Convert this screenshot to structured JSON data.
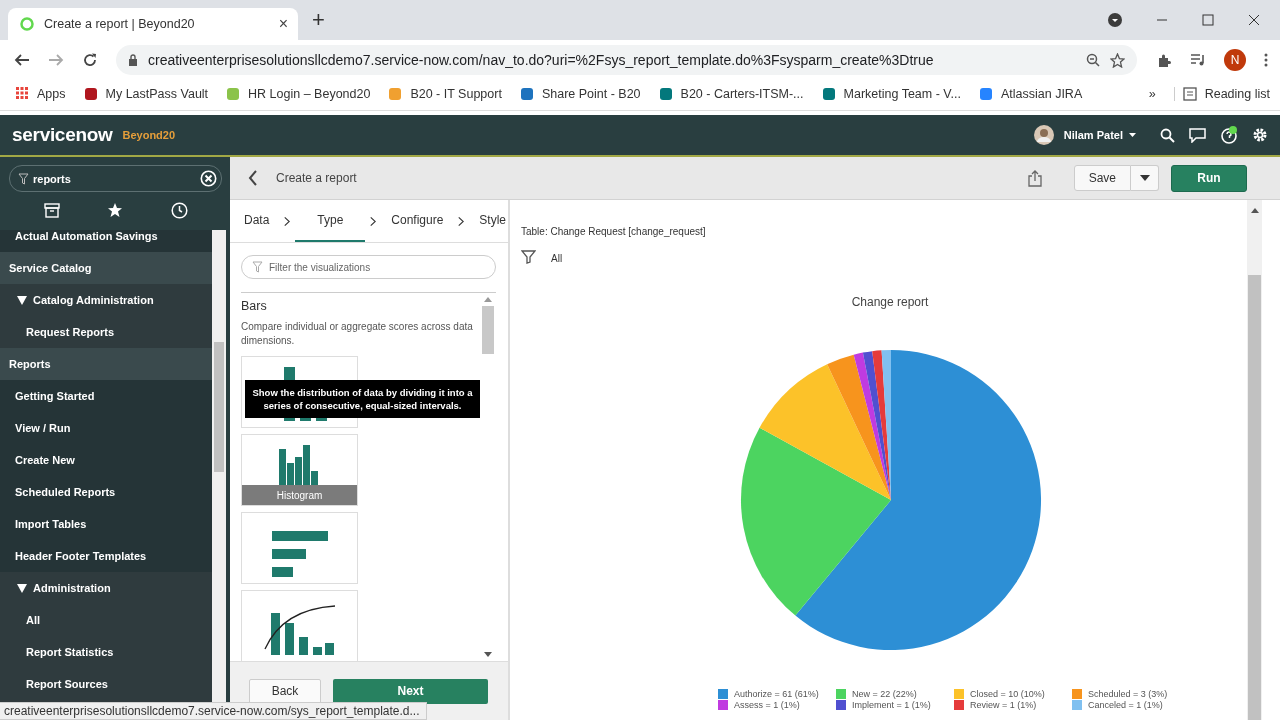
{
  "browser": {
    "tab": {
      "title": "Create a report | Beyond20",
      "close": "×"
    },
    "new_tab": "+",
    "url": "creativeenterprisesolutionsllcdemo7.service-now.com/nav_to.do?uri=%2Fsys_report_template.do%3Fsysparm_create%3Dtrue",
    "profile_initial": "N",
    "bookmarks": [
      {
        "label": "Apps",
        "color": "#e8453c"
      },
      {
        "label": "My LastPass Vault",
        "color": "#b0161e"
      },
      {
        "label": "HR Login – Beyond20",
        "color": "#8bc34a"
      },
      {
        "label": "B20 - IT Support",
        "color": "#f0a030"
      },
      {
        "label": "Share Point - B20",
        "color": "#1e73be"
      },
      {
        "label": "B20 - Carters-ITSM-...",
        "color": "#03787c"
      },
      {
        "label": "Marketing Team - V...",
        "color": "#03787c"
      },
      {
        "label": "Atlassian JIRA",
        "color": "#2684ff"
      }
    ],
    "more": "»",
    "reading_list": "Reading list",
    "status_url": "creativeenterprisesolutionsllcdemo7.service-now.com/sys_report_template.d..."
  },
  "header": {
    "logo": "servicenow",
    "instance": "Beyond20",
    "user": "Nilam Patel"
  },
  "sidebar": {
    "search": "reports",
    "tabs": [
      {
        "kind": "archive",
        "selected": false
      },
      {
        "kind": "star",
        "selected": false
      },
      {
        "kind": "history",
        "selected": false
      }
    ],
    "nav": [
      {
        "kind": "continued",
        "children": [
          {
            "kind": "link",
            "label": "Actual Automation Savings"
          }
        ]
      },
      {
        "kind": "section",
        "label": "Service Catalog",
        "children": [
          {
            "kind": "folder",
            "label": "Catalog Administration",
            "expanded": true,
            "children": [
              {
                "kind": "link",
                "label": "Request Reports"
              }
            ]
          }
        ]
      },
      {
        "kind": "section",
        "label": "Reports",
        "children": [
          {
            "kind": "link",
            "label": "Getting Started"
          },
          {
            "kind": "link",
            "label": "View / Run"
          },
          {
            "kind": "link",
            "label": "Create New"
          },
          {
            "kind": "link",
            "label": "Scheduled Reports"
          },
          {
            "kind": "link",
            "label": "Import Tables"
          },
          {
            "kind": "link",
            "label": "Header Footer Templates"
          },
          {
            "kind": "folder",
            "label": "Administration",
            "expanded": true,
            "children": [
              {
                "kind": "link",
                "label": "All"
              },
              {
                "kind": "link",
                "label": "Report Statistics"
              },
              {
                "kind": "link",
                "label": "Report Sources"
              }
            ]
          }
        ]
      }
    ]
  },
  "page": {
    "title": "Create a report",
    "save": "Save",
    "run": "Run",
    "steps": [
      {
        "label": "Data",
        "selected": false
      },
      {
        "label": "Type",
        "selected": true
      },
      {
        "label": "Configure",
        "selected": false
      },
      {
        "label": "Style",
        "selected": false
      }
    ],
    "filter_placeholder": "Filter the visualizations",
    "group": {
      "title": "Bars",
      "description": "Compare individual or aggregate scores across data dimensions."
    },
    "cards": [
      {
        "kind": "vertical-bars"
      },
      {
        "kind": "histogram",
        "label": "Histogram"
      },
      {
        "kind": "horizontal-bars"
      },
      {
        "kind": "pareto"
      }
    ],
    "tooltip": "Show the distribution of data by dividing it into a series of consecutive, equal-sized intervals.",
    "back": "Back",
    "next": "Next"
  },
  "report": {
    "table": "Table: Change Request [change_request]",
    "filter": "All",
    "chart_data": {
      "type": "pie",
      "title": "Change report",
      "categories": [
        "Authorize = 61 (61%)",
        "New = 22 (22%)",
        "Closed = 10 (10%)",
        "Scheduled = 3 (3%)",
        "Assess = 1 (1%)",
        "Implement = 1 (1%)",
        "Review = 1 (1%)",
        "Canceled = 1 (1%)"
      ],
      "values": [
        61,
        22,
        10,
        3,
        1,
        1,
        1,
        1
      ]
    },
    "legend": [
      {
        "color": "#2d8fd5"
      },
      {
        "color": "#4cd460"
      },
      {
        "color": "#fcc229"
      },
      {
        "color": "#f7941d"
      },
      {
        "color": "#c03be0"
      },
      {
        "color": "#5050d0"
      },
      {
        "color": "#e53b3b"
      },
      {
        "color": "#80c0f0"
      }
    ]
  }
}
